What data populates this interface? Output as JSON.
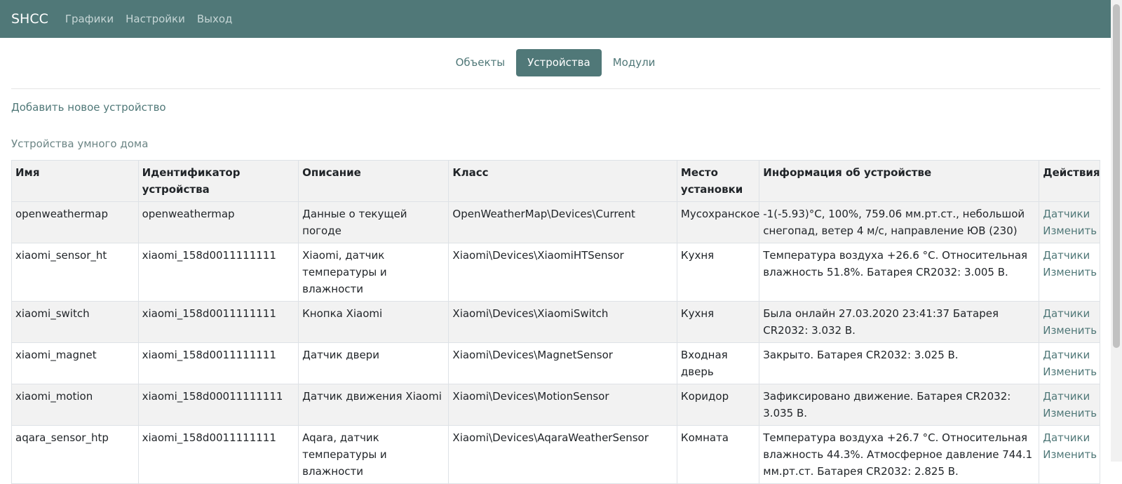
{
  "navbar": {
    "brand": "SHCC",
    "links": [
      "Графики",
      "Настройки",
      "Выход"
    ]
  },
  "tabs": [
    {
      "label": "Объекты",
      "active": false
    },
    {
      "label": "Устройства",
      "active": true
    },
    {
      "label": "Модули",
      "active": false
    }
  ],
  "add_device_label": "Добавить новое устройство",
  "section_title": "Устройства умного дома",
  "table": {
    "headers": [
      "Имя",
      "Идентификатор устройства",
      "Описание",
      "Класс",
      "Место установки",
      "Информация об устройстве",
      "Действия"
    ],
    "rows": [
      {
        "name": "openweathermap",
        "id": "openweathermap",
        "description": "Данные о текущей погоде",
        "class": "OpenWeatherMap\\Devices\\Current",
        "place": "Мусохранское",
        "info": "-1(-5.93)°C, 100%, 759.06 мм.рт.ст., небольшой снегопад, ветер 4 м/с, направление ЮВ (230)",
        "actions": [
          "Датчики",
          "Изменить"
        ]
      },
      {
        "name": "xiaomi_sensor_ht",
        "id": "xiaomi_158d0011111111",
        "description": "Xiaomi, датчик температуры и влажности",
        "class": "Xiaomi\\Devices\\XiaomiHTSensor",
        "place": "Кухня",
        "info": "Температура воздуха +26.6 °C. Относительная влажность 51.8%. Батарея CR2032: 3.005 В.",
        "actions": [
          "Датчики",
          "Изменить"
        ]
      },
      {
        "name": "xiaomi_switch",
        "id": "xiaomi_158d0011111111",
        "description": "Кнопка Xiaomi",
        "class": "Xiaomi\\Devices\\XiaomiSwitch",
        "place": "Кухня",
        "info": "Была онлайн 27.03.2020 23:41:37 Батарея CR2032: 3.032 В.",
        "actions": [
          "Датчики",
          "Изменить"
        ]
      },
      {
        "name": "xiaomi_magnet",
        "id": "xiaomi_158d0011111111",
        "description": "Датчик двери",
        "class": "Xiaomi\\Devices\\MagnetSensor",
        "place": "Входная дверь",
        "info": "Закрыто. Батарея CR2032: 3.025 В.",
        "actions": [
          "Датчики",
          "Изменить"
        ]
      },
      {
        "name": "xiaomi_motion",
        "id": "xiaomi_158d00011111111",
        "description": "Датчик движения Xiaomi",
        "class": "Xiaomi\\Devices\\MotionSensor",
        "place": "Коридор",
        "info": "Зафиксировано движение. Батарея CR2032: 3.035 В.",
        "actions": [
          "Датчики",
          "Изменить"
        ]
      },
      {
        "name": "aqara_sensor_htp",
        "id": "xiaomi_158d0011111111",
        "description": "Aqara, датчик температуры и влажности",
        "class": "Xiaomi\\Devices\\AqaraWeatherSensor",
        "place": "Комната",
        "info": "Температура воздуха +26.7 °C. Относительная влажность 44.3%. Атмосферное давление 744.1 мм.рт.ст. Батарея CR2032: 2.825 В.",
        "actions": [
          "Датчики",
          "Изменить"
        ]
      }
    ]
  },
  "colors": {
    "navbar_bg": "#507878",
    "accent": "#507878",
    "row_stripe": "#f2f2f2"
  }
}
